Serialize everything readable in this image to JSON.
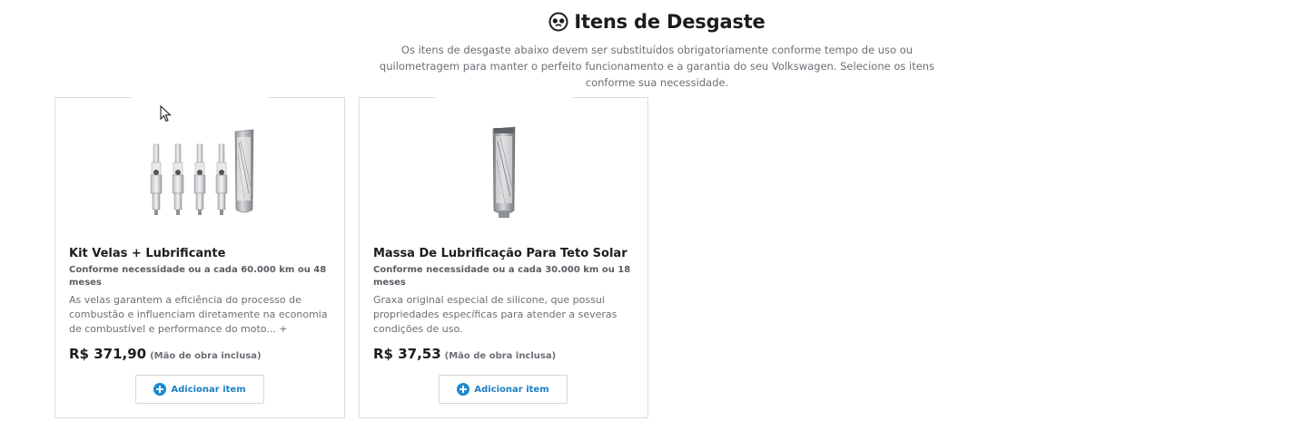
{
  "header": {
    "title": "Itens de Desgaste",
    "subtitle": "Os itens de desgaste abaixo devem ser substituídos obrigatoriamente conforme tempo de uso ou quilometragem para manter o perfeito funcionamento e a garantia do seu Volkswagen. Selecione os itens conforme sua necessidade.",
    "icon": "wear-parts-icon"
  },
  "products": [
    {
      "title": "Kit Velas + Lubrificante",
      "period": "Conforme necessidade ou a cada 60.000 km ou 48 meses",
      "description": "As velas garantem a eficiência do processo de combustão e influenciam diretamente na economia de combustível e performance do moto...",
      "more": "+",
      "price": "R$ 371,90",
      "labor": "(Mão de obra inclusa)",
      "add_label": "Adicionar item",
      "image": "spark-plugs-and-lubricant-tube"
    },
    {
      "title": "Massa De Lubrificação Para Teto Solar",
      "period": "Conforme necessidade ou a cada 30.000 km ou 18 meses",
      "description": "Graxa original especial de silicone, que possui propriedades específicas para atender a severas condições de uso.",
      "more": "",
      "price": "R$ 37,53",
      "labor": "(Mão de obra inclusa)",
      "add_label": "Adicionar item",
      "image": "lubricant-tube"
    }
  ],
  "colors": {
    "accent": "#1b8ad1",
    "text": "#1c1c1c",
    "muted": "#6b6f75",
    "border": "#dcdcdc"
  }
}
